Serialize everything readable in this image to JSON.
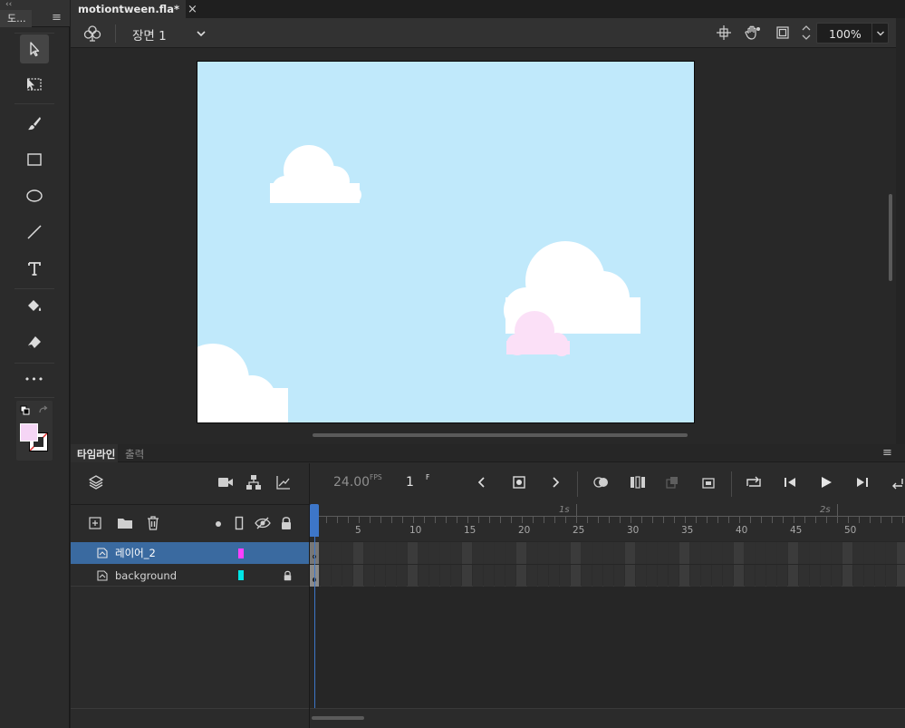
{
  "tools_panel": {
    "title": "도...",
    "collapse_glyph": "‹‹",
    "menu_glyph": "≡",
    "more_glyph": "•••",
    "stroke_color": "#f5d5f5",
    "fill_color": "#ffffff",
    "tools": [
      {
        "name": "selection-tool",
        "icon": "arrow-icon",
        "selected": true
      },
      {
        "name": "free-transform-tool",
        "icon": "transform-icon"
      },
      {
        "name": "brush-tool",
        "icon": "brush-icon"
      },
      {
        "name": "rectangle-tool",
        "icon": "rectangle-icon"
      },
      {
        "name": "oval-tool",
        "icon": "oval-icon"
      },
      {
        "name": "line-tool",
        "icon": "line-icon"
      },
      {
        "name": "text-tool",
        "icon": "text-icon"
      },
      {
        "name": "paint-bucket-tool",
        "icon": "paint-bucket-icon"
      },
      {
        "name": "eraser-tool",
        "icon": "eraser-icon"
      }
    ]
  },
  "document": {
    "tab_title": "motiontween.fla*",
    "tab_close": "×",
    "scene_label": "장면 1",
    "zoom": "100%",
    "stage_color": "#c0e9fb"
  },
  "timeline": {
    "tabs": [
      "타임라인",
      "출력"
    ],
    "fps": "24.00",
    "fps_unit": "FPS",
    "frame": "1",
    "frame_unit": "F",
    "second_markers": [
      "1s",
      "2s"
    ],
    "frame_numbers": [
      "5",
      "10",
      "15",
      "20",
      "25",
      "30",
      "35",
      "40",
      "45",
      "50"
    ],
    "layers": [
      {
        "name": "레이어_2",
        "color": "#ff40ff",
        "selected": true,
        "locked": false
      },
      {
        "name": "background",
        "color": "#00e5e5",
        "selected": false,
        "locked": true
      }
    ]
  },
  "colors": {
    "accent": "#3d76c8",
    "selected_layer": "#3a6aa0",
    "cloud_pink": "#fbe0f7"
  }
}
